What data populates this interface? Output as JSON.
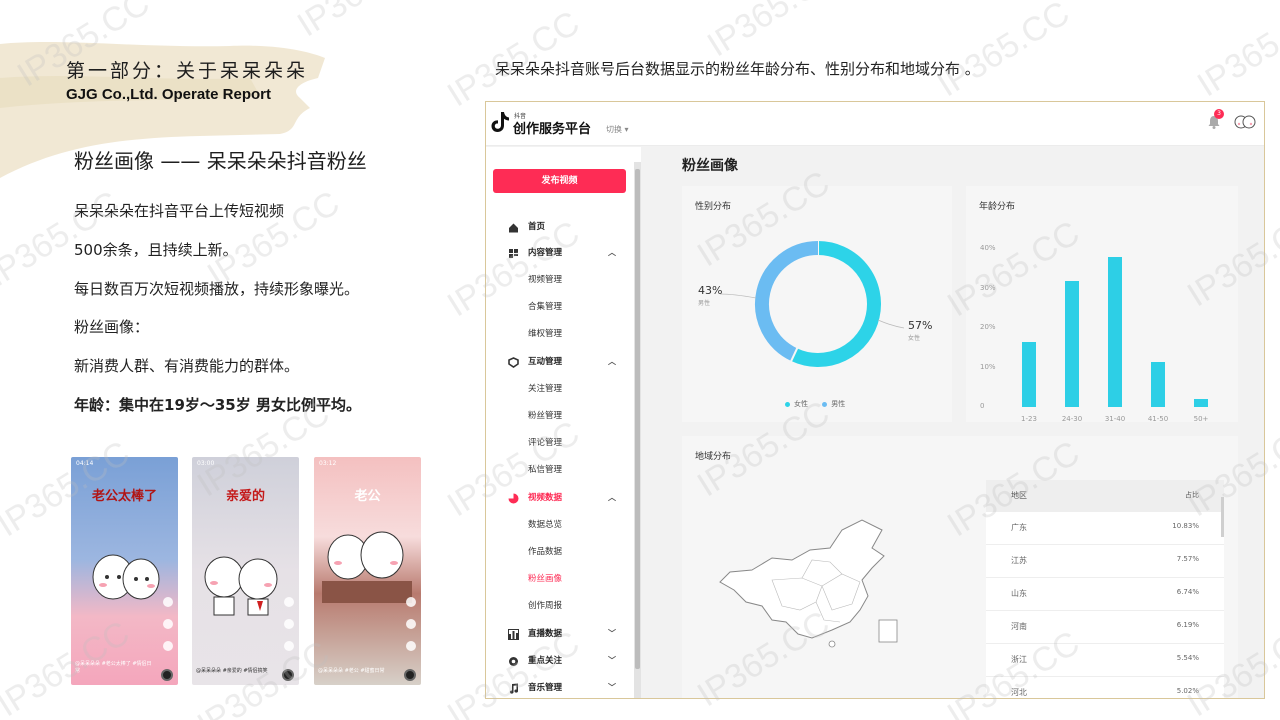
{
  "slide": {
    "part_title": "第一部分：关于呆呆朵朵",
    "part_subtitle": "GJG Co.,Ltd. Operate Report",
    "persona_title": "粉丝画像 —— 呆呆朵朵抖音粉丝",
    "paragraphs": [
      "呆呆朵朵在抖音平台上传短视频",
      "500余条，且持续上新。",
      "每日数百万次短视频播放，持续形象曝光。",
      "粉丝画像：",
      "新消费人群、有消费能力的群体。"
    ],
    "highlight": "年龄：集中在19岁～35岁  男女比例平均。",
    "caption": "呆呆朵朵抖音账号后台数据显示的粉丝年龄分布、性别分布和地域分布 。"
  },
  "phones": [
    {
      "status": "04:14",
      "caption": "老公太棒了",
      "bg": "#7aa0d6",
      "meta": "@呆呆朵朵 #老公太棒了 #情侣日常"
    },
    {
      "status": "03:00",
      "caption": "亲爱的",
      "bg": "#d8d8e0",
      "meta": "@呆呆朵朵 #亲爱的 #情侣搞笑"
    },
    {
      "status": "03:12",
      "caption": "老公",
      "bg": "#f3c6c6",
      "meta": "@呆呆朵朵 #老公 #甜蜜日常"
    }
  ],
  "app": {
    "logo_small": "抖音",
    "logo_text": "创作服务平台",
    "switch_label": "切换",
    "notification_count": "3",
    "publish_button": "发布视频",
    "nav": [
      {
        "label": "首页",
        "level": "top",
        "icon": "home-icon"
      },
      {
        "label": "内容管理",
        "level": "top",
        "icon": "content-icon",
        "chevron": "^"
      },
      {
        "label": "视频管理",
        "level": "sub"
      },
      {
        "label": "合集管理",
        "level": "sub"
      },
      {
        "label": "维权管理",
        "level": "sub"
      },
      {
        "label": "互动管理",
        "level": "top",
        "icon": "interaction-icon",
        "chevron": "^"
      },
      {
        "label": "关注管理",
        "level": "sub"
      },
      {
        "label": "粉丝管理",
        "level": "sub"
      },
      {
        "label": "评论管理",
        "level": "sub"
      },
      {
        "label": "私信管理",
        "level": "sub"
      },
      {
        "label": "视频数据",
        "level": "top",
        "icon": "video-data-icon",
        "chevron": "^",
        "active": true
      },
      {
        "label": "数据总览",
        "level": "sub"
      },
      {
        "label": "作品数据",
        "level": "sub"
      },
      {
        "label": "粉丝画像",
        "level": "sub",
        "active": true
      },
      {
        "label": "创作周报",
        "level": "sub"
      },
      {
        "label": "直播数据",
        "level": "top",
        "icon": "live-data-icon",
        "chevron": "v"
      },
      {
        "label": "重点关注",
        "level": "top",
        "icon": "focus-icon",
        "chevron": "v"
      },
      {
        "label": "音乐管理",
        "level": "top",
        "icon": "music-icon",
        "chevron": "v"
      }
    ],
    "page_title": "粉丝画像",
    "gender": {
      "title": "性别分布",
      "female_pct": "57%",
      "female_label": "女性",
      "male_pct": "43%",
      "male_label": "男性",
      "female_value": 57,
      "male_value": 43,
      "colors": {
        "female": "#2dd3e8",
        "male": "#6bbcf2"
      },
      "legend": [
        "女性",
        "男性"
      ]
    },
    "age": {
      "title": "年龄分布",
      "categories": [
        "1-23",
        "24-30",
        "31-40",
        "41-50",
        "50+"
      ],
      "values": [
        16.5,
        32,
        38,
        11.5,
        2
      ],
      "y_ticks": [
        "40%",
        "30%",
        "20%",
        "10%",
        "0"
      ],
      "ylim": [
        0,
        40
      ]
    },
    "region": {
      "title": "地域分布",
      "col_region": "地区",
      "col_share": "占比",
      "rows": [
        {
          "name": "广东",
          "share": "10.83%"
        },
        {
          "name": "江苏",
          "share": "7.57%"
        },
        {
          "name": "山东",
          "share": "6.74%"
        },
        {
          "name": "河南",
          "share": "6.19%"
        },
        {
          "name": "浙江",
          "share": "5.54%"
        },
        {
          "name": "河北",
          "share": "5.02%"
        }
      ]
    }
  },
  "watermark": "IP365.CC",
  "chart_data": [
    {
      "type": "pie",
      "title": "性别分布",
      "categories": [
        "女性",
        "男性"
      ],
      "values": [
        57,
        43
      ]
    },
    {
      "type": "bar",
      "title": "年龄分布",
      "categories": [
        "1-23",
        "24-30",
        "31-40",
        "41-50",
        "50+"
      ],
      "values": [
        16.5,
        32,
        38,
        11.5,
        2
      ],
      "ylim": [
        0,
        40
      ]
    }
  ]
}
